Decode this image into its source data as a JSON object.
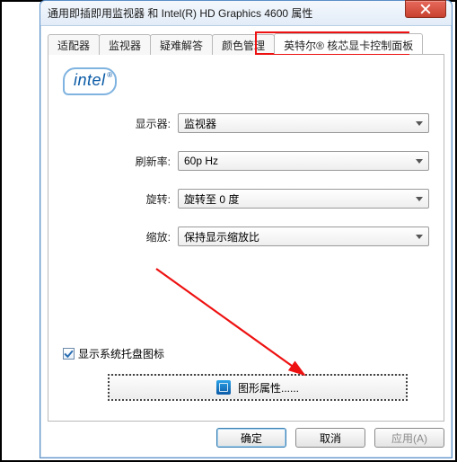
{
  "window": {
    "title": "通用即插即用监视器 和 Intel(R) HD Graphics 4600 属性"
  },
  "tabs": {
    "t0": "适配器",
    "t1": "监视器",
    "t2": "疑难解答",
    "t3": "颜色管理",
    "t4": "英特尔® 核芯显卡控制面板"
  },
  "logo": {
    "text": "intel"
  },
  "form": {
    "display_label": "显示器:",
    "display_value": "监视器",
    "refresh_label": "刷新率:",
    "refresh_value": "60p Hz",
    "rotate_label": "旋转:",
    "rotate_value": "旋转至 0 度",
    "scale_label": "缩放:",
    "scale_value": "保持显示缩放比"
  },
  "tray": {
    "label": "显示系统托盘图标",
    "checked": true
  },
  "gfx_button": {
    "label": "图形属性......"
  },
  "footer": {
    "ok": "确定",
    "cancel": "取消",
    "apply": "应用(A)"
  }
}
